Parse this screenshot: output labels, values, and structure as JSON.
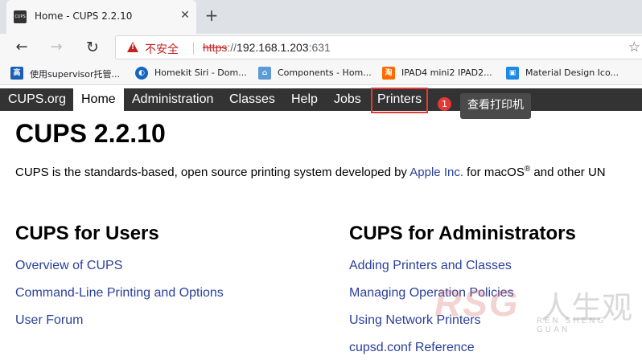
{
  "browser": {
    "tab": {
      "favicon_text": "CUPS",
      "title": "Home - CUPS 2.2.10",
      "close_glyph": "✕"
    },
    "new_tab_glyph": "+",
    "nav": {
      "back_glyph": "←",
      "forward_glyph": "→",
      "reload_glyph": "↻"
    },
    "address": {
      "security_label": "不安全",
      "scheme": "https",
      "separator": "://",
      "host": "192.168.1.203",
      "port": ":631",
      "star_glyph": "☆"
    },
    "bookmarks": [
      {
        "icon_text": "高",
        "icon_color": "#1a5fb4",
        "label": "使用supervisor托管..."
      },
      {
        "icon_text": "◐",
        "icon_color": "#1565c0",
        "label": "Homekit Siri - Dom..."
      },
      {
        "icon_text": "⌂",
        "icon_color": "#5c9bd5",
        "label": "Components - Hom..."
      },
      {
        "icon_text": "淘",
        "icon_color": "#ff6a00",
        "label": "IPAD4 mini2 IPAD2..."
      },
      {
        "icon_text": "▣",
        "icon_color": "#1e88e5",
        "label": "Material Design Ico..."
      }
    ]
  },
  "cups_nav": {
    "items": [
      {
        "label": "CUPS.org"
      },
      {
        "label": "Home"
      },
      {
        "label": "Administration"
      },
      {
        "label": "Classes"
      },
      {
        "label": "Help"
      },
      {
        "label": "Jobs"
      },
      {
        "label": "Printers"
      }
    ],
    "active": "Home"
  },
  "annotation": {
    "step": "1",
    "tooltip": "查看打印机",
    "highlight_color": "#e53935"
  },
  "page": {
    "title": "CUPS 2.2.10",
    "intro_before": "CUPS is the standards-based, open source printing system developed by ",
    "intro_link": "Apple Inc.",
    "intro_after": " for macOS",
    "intro_reg": "®",
    "intro_tail": " and other UN",
    "users": {
      "heading": "CUPS for Users",
      "links": [
        "Overview of CUPS",
        "Command-Line Printing and Options",
        "User Forum"
      ]
    },
    "admins": {
      "heading": "CUPS for Administrators",
      "links": [
        "Adding Printers and Classes",
        "Managing Operation Policies",
        "Using Network Printers",
        "cupsd.conf Reference"
      ]
    }
  },
  "watermark": {
    "brand": "RSG",
    "cn": "人生观",
    "en": "REN SHENG GUAN"
  }
}
